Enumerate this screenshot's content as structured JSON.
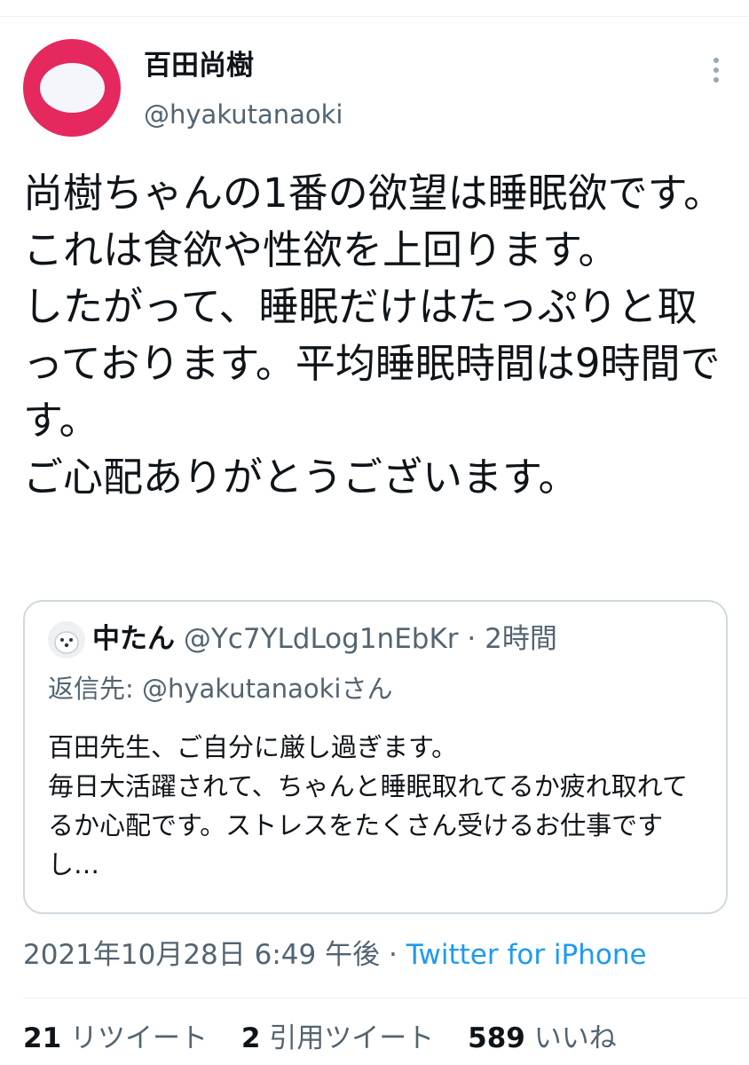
{
  "tweet": {
    "author": {
      "name": "百田尚樹",
      "handle": "@hyakutanaoki",
      "avatar_color": "#e5285e"
    },
    "more_icon": "more-dots-icon",
    "text": "尚樹ちゃんの1番の欲望は睡眠欲です。これは食欲や性欲を上回ります。\nしたがって、睡眠だけはたっぷりと取っております。平均睡眠時間は9時間です。\nご心配ありがとうございます。",
    "timestamp": "2021年10月28日 6:49 午後",
    "separator": "·",
    "source": "Twitter for iPhone",
    "source_color": "#1d9bf0"
  },
  "quote": {
    "author_name": "中たん",
    "author_handle": "@Yc7YLdLog1nEbKr",
    "separator": "·",
    "time": "2時間",
    "reply_to": "返信先: @hyakutanaokiさん",
    "text": "百田先生、ご自分に厳し過ぎます。\n毎日大活躍されて、ちゃんと睡眠取れてるか疲れ取れてるか心配です。ストレスをたくさん受けるお仕事ですし…"
  },
  "stats": {
    "retweets_count": "21",
    "retweets_label": "リツイート",
    "quotes_count": "2",
    "quotes_label": "引用ツイート",
    "likes_count": "589",
    "likes_label": "いいね"
  }
}
